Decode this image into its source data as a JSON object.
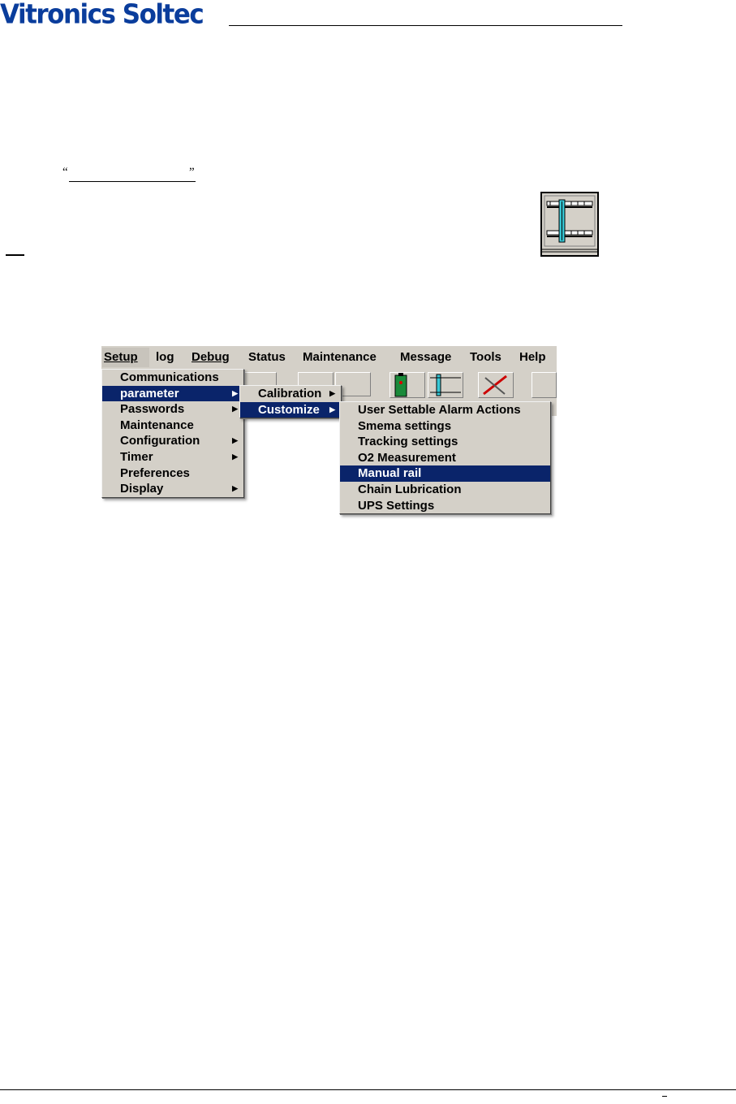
{
  "header": {
    "logo_text": "Vitronics Soltec",
    "logo_color": "#0a3d9c"
  },
  "body": {
    "quote_open": "“",
    "quote_close": "”"
  },
  "icons": {
    "rail_icon": "manual-rail-icon"
  },
  "menubar": {
    "items": [
      "Setup",
      "log",
      "Debug",
      "Status",
      "Maintenance",
      "Message",
      "Tools",
      "Help"
    ]
  },
  "setup_menu": {
    "items": [
      "Communications",
      "parameter",
      "Passwords",
      "Maintenance",
      "Configuration",
      "Timer",
      "Preferences",
      "Display"
    ]
  },
  "parameter_menu": {
    "items": [
      "Calibration",
      "Customize"
    ]
  },
  "customize_menu": {
    "items": [
      "User Settable Alarm Actions",
      "Smema settings",
      "Tracking settings",
      "O2 Measurement",
      "Manual rail",
      "Chain Lubrication",
      "UPS Settings"
    ]
  },
  "colors": {
    "menu_bg": "#d4d0c8",
    "highlight": "#0a246a",
    "highlight_text": "#ffffff"
  }
}
